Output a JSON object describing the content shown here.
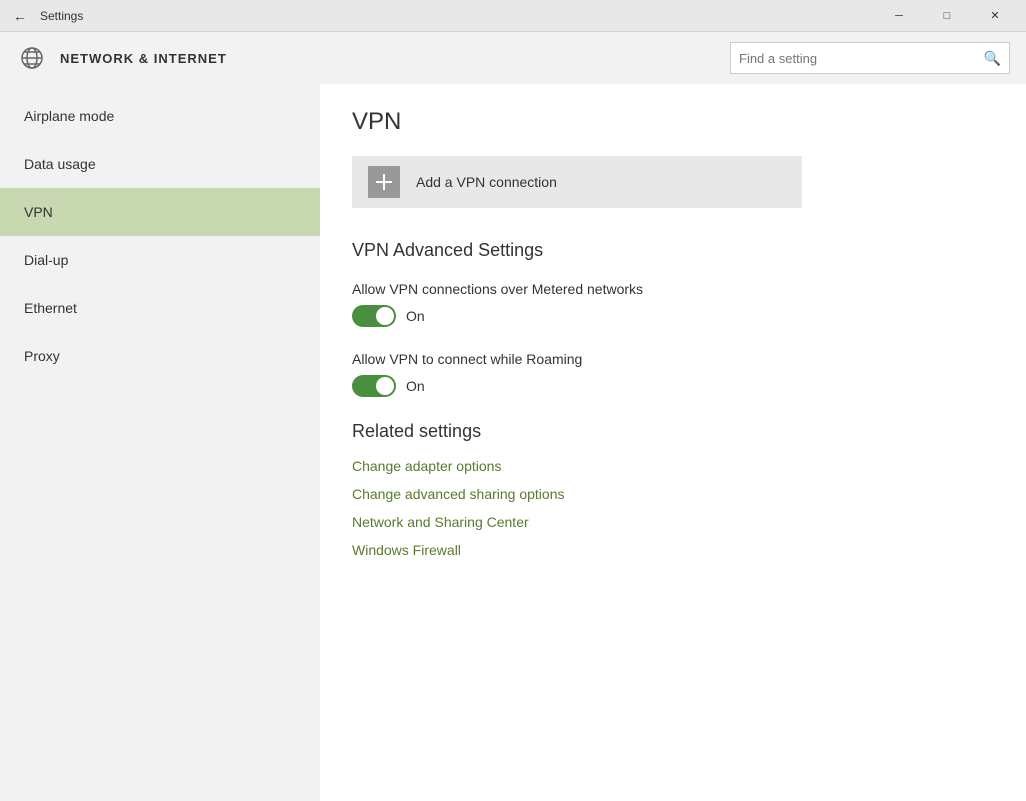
{
  "titlebar": {
    "title": "Settings",
    "back_label": "←",
    "minimize_label": "─",
    "maximize_label": "□",
    "close_label": "✕"
  },
  "header": {
    "title": "NETWORK & INTERNET",
    "search_placeholder": "Find a setting"
  },
  "sidebar": {
    "items": [
      {
        "id": "airplane-mode",
        "label": "Airplane mode",
        "active": false
      },
      {
        "id": "data-usage",
        "label": "Data usage",
        "active": false
      },
      {
        "id": "vpn",
        "label": "VPN",
        "active": true
      },
      {
        "id": "dial-up",
        "label": "Dial-up",
        "active": false
      },
      {
        "id": "ethernet",
        "label": "Ethernet",
        "active": false
      },
      {
        "id": "proxy",
        "label": "Proxy",
        "active": false
      }
    ]
  },
  "content": {
    "page_title": "VPN",
    "add_vpn_label": "Add a VPN connection",
    "advanced_section_title": "VPN Advanced Settings",
    "toggle1": {
      "label": "Allow VPN connections over Metered networks",
      "state": "On",
      "enabled": true
    },
    "toggle2": {
      "label": "Allow VPN to connect while Roaming",
      "state": "On",
      "enabled": true
    },
    "related_section_title": "Related settings",
    "links": [
      {
        "label": "Change adapter options"
      },
      {
        "label": "Change advanced sharing options"
      },
      {
        "label": "Network and Sharing Center"
      },
      {
        "label": "Windows Firewall"
      }
    ]
  }
}
